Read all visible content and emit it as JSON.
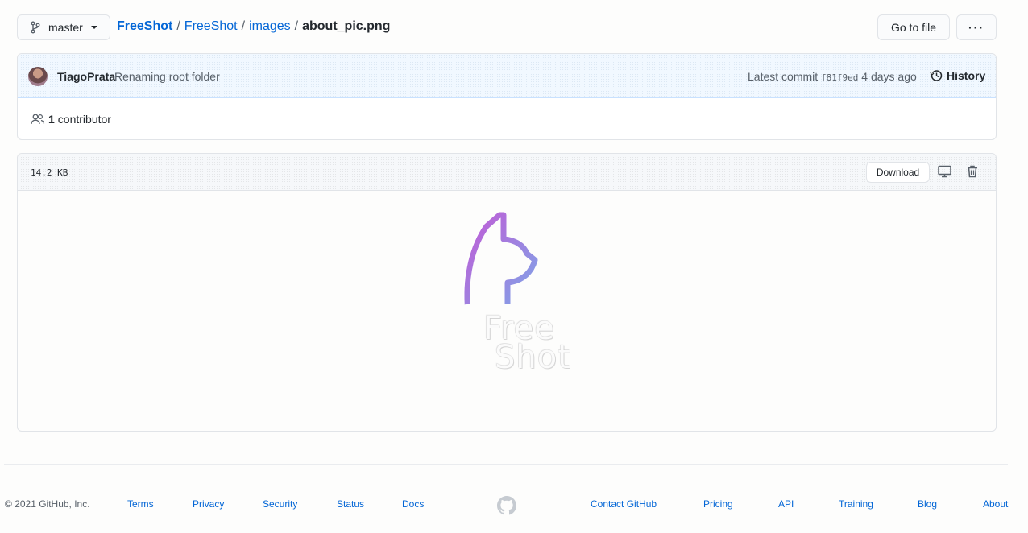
{
  "branch": {
    "label": "master"
  },
  "breadcrumb": {
    "repo": "FreeShot",
    "folder1": "FreeShot",
    "folder2": "images",
    "sep": "/",
    "file": "about_pic.png"
  },
  "actions": {
    "goto_file": "Go to file",
    "more": "···"
  },
  "commit": {
    "author": "TiagoPrata",
    "message": "Renaming root folder",
    "latest_prefix": "Latest commit",
    "sha": "f81f9ed",
    "age": "4 days ago",
    "history": "History"
  },
  "contributors": {
    "count": "1",
    "label": "contributor"
  },
  "file": {
    "size": "14.2 KB",
    "download": "Download",
    "image_text_line1": "Free",
    "image_text_line2": "Shot"
  },
  "footer": {
    "copyright": "© 2021 GitHub, Inc.",
    "links": [
      "Terms",
      "Privacy",
      "Security",
      "Status",
      "Docs",
      "Contact GitHub",
      "Pricing",
      "API",
      "Training",
      "Blog",
      "About"
    ]
  },
  "colors": {
    "link": "#0366d6",
    "logo_gradient_start": "#c25bd6",
    "logo_gradient_end": "#7ea5e8"
  }
}
